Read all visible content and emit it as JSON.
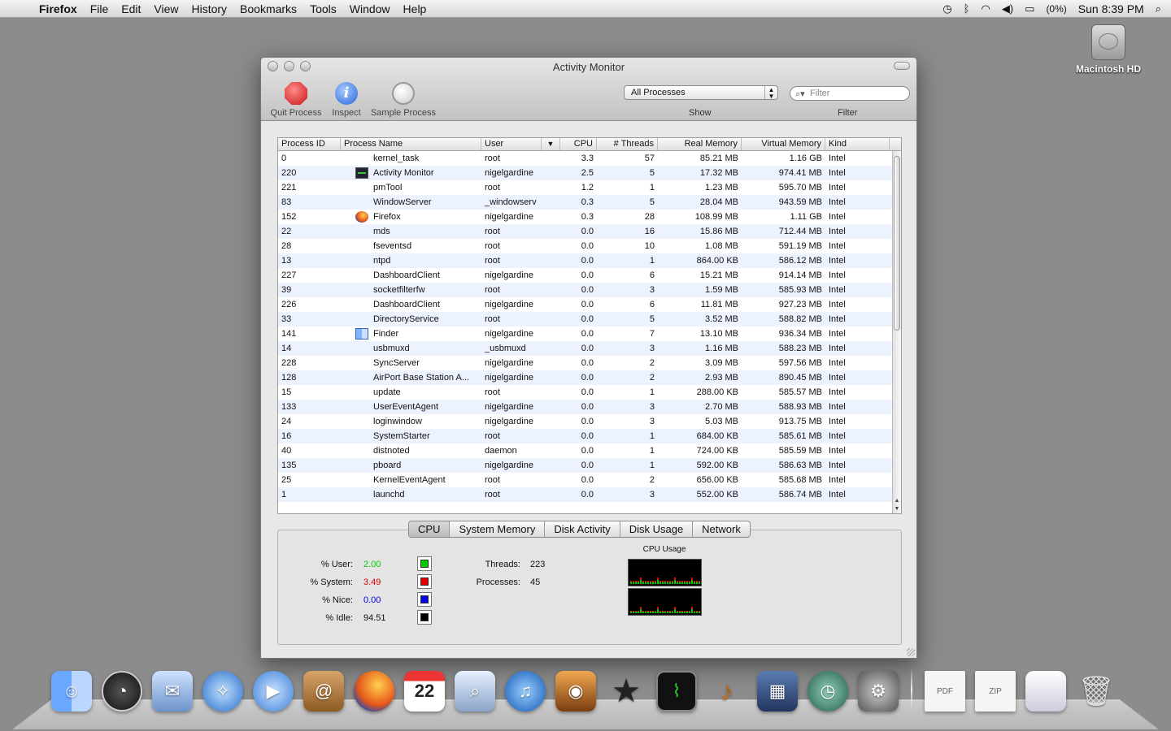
{
  "menubar": {
    "apple": "",
    "app": "Firefox",
    "menus": [
      "File",
      "Edit",
      "View",
      "History",
      "Bookmarks",
      "Tools",
      "Window",
      "Help"
    ],
    "battery": "(0%)",
    "clock": "Sun 8:39 PM"
  },
  "desktop": {
    "hd_label": "Macintosh HD"
  },
  "window": {
    "title": "Activity Monitor",
    "toolbar": {
      "quit": "Quit Process",
      "inspect": "Inspect",
      "sample": "Sample Process",
      "show_value": "All Processes",
      "show_label": "Show",
      "filter_placeholder": "Filter",
      "filter_label": "Filter"
    },
    "columns": [
      "Process ID",
      "Process Name",
      "User",
      "",
      "CPU",
      "# Threads",
      "Real Memory",
      "Virtual Memory",
      "Kind"
    ],
    "rows": [
      {
        "pid": "0",
        "name": "kernel_task",
        "icon": "",
        "user": "root",
        "cpu": "3.3",
        "threads": "57",
        "real": "85.21 MB",
        "virt": "1.16 GB",
        "kind": "Intel"
      },
      {
        "pid": "220",
        "name": "Activity Monitor",
        "icon": "activity-monitor",
        "user": "nigelgardine",
        "cpu": "2.5",
        "threads": "5",
        "real": "17.32 MB",
        "virt": "974.41 MB",
        "kind": "Intel"
      },
      {
        "pid": "221",
        "name": "pmTool",
        "icon": "",
        "user": "root",
        "cpu": "1.2",
        "threads": "1",
        "real": "1.23 MB",
        "virt": "595.70 MB",
        "kind": "Intel"
      },
      {
        "pid": "83",
        "name": "WindowServer",
        "icon": "",
        "user": "_windowserv",
        "cpu": "0.3",
        "threads": "5",
        "real": "28.04 MB",
        "virt": "943.59 MB",
        "kind": "Intel"
      },
      {
        "pid": "152",
        "name": "Firefox",
        "icon": "firefox",
        "user": "nigelgardine",
        "cpu": "0.3",
        "threads": "28",
        "real": "108.99 MB",
        "virt": "1.11 GB",
        "kind": "Intel"
      },
      {
        "pid": "22",
        "name": "mds",
        "icon": "",
        "user": "root",
        "cpu": "0.0",
        "threads": "16",
        "real": "15.86 MB",
        "virt": "712.44 MB",
        "kind": "Intel"
      },
      {
        "pid": "28",
        "name": "fseventsd",
        "icon": "",
        "user": "root",
        "cpu": "0.0",
        "threads": "10",
        "real": "1.08 MB",
        "virt": "591.19 MB",
        "kind": "Intel"
      },
      {
        "pid": "13",
        "name": "ntpd",
        "icon": "",
        "user": "root",
        "cpu": "0.0",
        "threads": "1",
        "real": "864.00 KB",
        "virt": "586.12 MB",
        "kind": "Intel"
      },
      {
        "pid": "227",
        "name": "DashboardClient",
        "icon": "",
        "user": "nigelgardine",
        "cpu": "0.0",
        "threads": "6",
        "real": "15.21 MB",
        "virt": "914.14 MB",
        "kind": "Intel"
      },
      {
        "pid": "39",
        "name": "socketfilterfw",
        "icon": "",
        "user": "root",
        "cpu": "0.0",
        "threads": "3",
        "real": "1.59 MB",
        "virt": "585.93 MB",
        "kind": "Intel"
      },
      {
        "pid": "226",
        "name": "DashboardClient",
        "icon": "",
        "user": "nigelgardine",
        "cpu": "0.0",
        "threads": "6",
        "real": "11.81 MB",
        "virt": "927.23 MB",
        "kind": "Intel"
      },
      {
        "pid": "33",
        "name": "DirectoryService",
        "icon": "",
        "user": "root",
        "cpu": "0.0",
        "threads": "5",
        "real": "3.52 MB",
        "virt": "588.82 MB",
        "kind": "Intel"
      },
      {
        "pid": "141",
        "name": "Finder",
        "icon": "finder",
        "user": "nigelgardine",
        "cpu": "0.0",
        "threads": "7",
        "real": "13.10 MB",
        "virt": "936.34 MB",
        "kind": "Intel"
      },
      {
        "pid": "14",
        "name": "usbmuxd",
        "icon": "",
        "user": "_usbmuxd",
        "cpu": "0.0",
        "threads": "3",
        "real": "1.16 MB",
        "virt": "588.23 MB",
        "kind": "Intel"
      },
      {
        "pid": "228",
        "name": "SyncServer",
        "icon": "",
        "user": "nigelgardine",
        "cpu": "0.0",
        "threads": "2",
        "real": "3.09 MB",
        "virt": "597.56 MB",
        "kind": "Intel"
      },
      {
        "pid": "128",
        "name": "AirPort Base Station A...",
        "icon": "",
        "user": "nigelgardine",
        "cpu": "0.0",
        "threads": "2",
        "real": "2.93 MB",
        "virt": "890.45 MB",
        "kind": "Intel"
      },
      {
        "pid": "15",
        "name": "update",
        "icon": "",
        "user": "root",
        "cpu": "0.0",
        "threads": "1",
        "real": "288.00 KB",
        "virt": "585.57 MB",
        "kind": "Intel"
      },
      {
        "pid": "133",
        "name": "UserEventAgent",
        "icon": "",
        "user": "nigelgardine",
        "cpu": "0.0",
        "threads": "3",
        "real": "2.70 MB",
        "virt": "588.93 MB",
        "kind": "Intel"
      },
      {
        "pid": "24",
        "name": "loginwindow",
        "icon": "",
        "user": "nigelgardine",
        "cpu": "0.0",
        "threads": "3",
        "real": "5.03 MB",
        "virt": "913.75 MB",
        "kind": "Intel"
      },
      {
        "pid": "16",
        "name": "SystemStarter",
        "icon": "",
        "user": "root",
        "cpu": "0.0",
        "threads": "1",
        "real": "684.00 KB",
        "virt": "585.61 MB",
        "kind": "Intel"
      },
      {
        "pid": "40",
        "name": "distnoted",
        "icon": "",
        "user": "daemon",
        "cpu": "0.0",
        "threads": "1",
        "real": "724.00 KB",
        "virt": "585.59 MB",
        "kind": "Intel"
      },
      {
        "pid": "135",
        "name": "pboard",
        "icon": "",
        "user": "nigelgardine",
        "cpu": "0.0",
        "threads": "1",
        "real": "592.00 KB",
        "virt": "586.63 MB",
        "kind": "Intel"
      },
      {
        "pid": "25",
        "name": "KernelEventAgent",
        "icon": "",
        "user": "root",
        "cpu": "0.0",
        "threads": "2",
        "real": "656.00 KB",
        "virt": "585.68 MB",
        "kind": "Intel"
      },
      {
        "pid": "1",
        "name": "launchd",
        "icon": "",
        "user": "root",
        "cpu": "0.0",
        "threads": "3",
        "real": "552.00 KB",
        "virt": "586.74 MB",
        "kind": "Intel"
      }
    ],
    "tabs": [
      "CPU",
      "System Memory",
      "Disk Activity",
      "Disk Usage",
      "Network"
    ],
    "active_tab": "CPU",
    "cpu_panel": {
      "user_label": "% User:",
      "user_value": "2.00",
      "user_color": "#00cc00",
      "system_label": "% System:",
      "system_value": "3.49",
      "system_color": "#e00000",
      "nice_label": "% Nice:",
      "nice_value": "0.00",
      "nice_color": "#0000e0",
      "idle_label": "% Idle:",
      "idle_value": "94.51",
      "idle_color": "#000000",
      "threads_label": "Threads:",
      "threads_value": "223",
      "processes_label": "Processes:",
      "processes_value": "45",
      "graph_title": "CPU Usage"
    }
  },
  "dock": {
    "apps": [
      "Finder",
      "Dashboard",
      "Mail",
      "Safari",
      "iChat",
      "Address Book",
      "Firefox",
      "iCal",
      "Preview",
      "iTunes",
      "iPhoto",
      "iMovie",
      "Activity Monitor",
      "GarageBand",
      "Spaces",
      "Time Machine",
      "System Preferences"
    ],
    "docs": [
      "PDF",
      "ZIP",
      "Screenshot",
      "Trash"
    ]
  }
}
